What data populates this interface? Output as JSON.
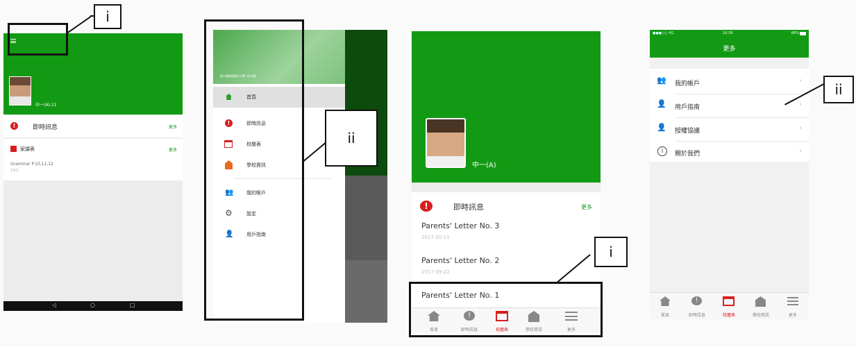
{
  "callouts": {
    "i_top": "i",
    "ii_left": "ii",
    "i_bottom": "i",
    "ii_right": "ii"
  },
  "s1": {
    "menu_icon": "menu-icon",
    "profile_name": "中一(A)-11",
    "notice_title": "即時訊息",
    "notice_more": "更多",
    "hw_title": "家課表",
    "hw_more": "更多",
    "hw_text": "Grammar P.10,11,12",
    "hw_sub": "19/3",
    "nav": [
      "◁",
      "○",
      "□"
    ]
  },
  "s2": {
    "header_text": "聖公會聖提摩太小學 (天水圍)",
    "menu": [
      {
        "label": "首頁",
        "icon": "home-icon"
      },
      {
        "label": "即時訊息",
        "icon": "notice-icon"
      },
      {
        "label": "校曆表",
        "icon": "calendar-icon"
      },
      {
        "label": "學校資訊",
        "icon": "school-icon"
      },
      {
        "label": "我的帳戶",
        "icon": "account-icon"
      },
      {
        "label": "設定",
        "icon": "settings-icon"
      },
      {
        "label": "用戶指南",
        "icon": "guide-icon"
      }
    ]
  },
  "s3": {
    "profile_name": "中一(A)",
    "notice_title": "即時訊息",
    "notice_more": "更多",
    "letters": [
      {
        "title": "Parents' Letter No. 3",
        "date": "2017-10-11"
      },
      {
        "title": "Parents' Letter No. 2",
        "date": "2017-09-22"
      },
      {
        "title": "Parents' Letter No. 1",
        "date": ""
      }
    ],
    "tabs": [
      "首頁",
      "即時訊息",
      "校曆表",
      "學校資訊",
      "更多"
    ]
  },
  "s4": {
    "status_left": "●●●○○ 4G",
    "status_time": "10:39",
    "status_right": "66%",
    "title": "更多",
    "rows": [
      {
        "label": "我的帳戶",
        "icon": "account-icon"
      },
      {
        "label": "用戶指南",
        "icon": "guide-icon"
      },
      {
        "label": "授權協議",
        "icon": "license-icon"
      },
      {
        "label": "關於我們",
        "icon": "info-icon"
      }
    ],
    "tabs": [
      "首頁",
      "即時訊息",
      "校曆表",
      "學校資訊",
      "更多"
    ]
  },
  "colors": {
    "green": "#139a14",
    "red": "#d81e1e"
  }
}
